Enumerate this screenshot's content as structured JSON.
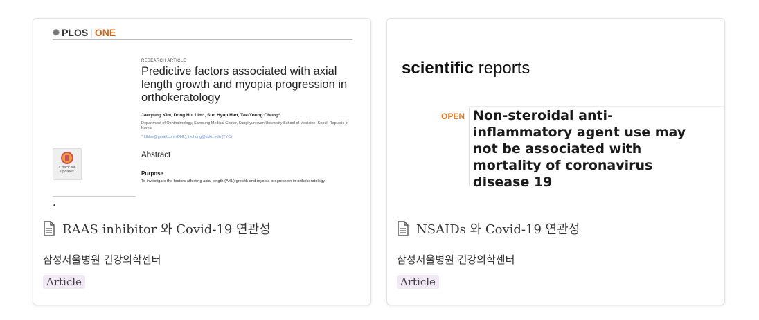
{
  "cards": [
    {
      "title": "RAAS inhibitor 와 Covid-19 연관성",
      "org": "삼성서울병원 건강의학센터",
      "tag": "Article",
      "thumb": {
        "logo_plos": "PLOS",
        "logo_sep": "|",
        "logo_one": "ONE",
        "research_article": "RESEARCH ARTICLE",
        "paper_title": "Predictive factors associated with axial length growth and myopia progression in orthokeratology",
        "authors": "Jaeryung Kim, Dong Hui Lim*, Sun Hyup Han, Tae-Young Chung*",
        "affiliation": "Department of Ophthalmology, Samsung Medical Center, Sungkyunkwan University School of Medicine, Seoul, Republic of Korea",
        "email": "* ldhlse@gmail.com (DHL); tychung@skku.edu (TYC)",
        "abstract": "Abstract",
        "purpose": "Purpose",
        "purpose_text": "To investigate the factors affecting axial length (AXL) growth and myopia progression in orthokeratology.",
        "check_badge": "Check for updates"
      }
    },
    {
      "title": "NSAIDs 와 Covid-19 연관성",
      "org": "삼성서울병원 건강의학센터",
      "tag": "Article",
      "thumb": {
        "logo_bold": "scientific",
        "logo_rest": " reports",
        "open": "OPEN",
        "paper_title": "Non-steroidal anti-inflammatory agent use may not be associated with mortality of coronavirus disease 19"
      }
    }
  ]
}
